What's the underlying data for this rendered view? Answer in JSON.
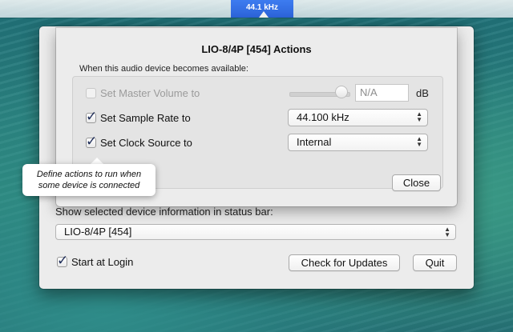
{
  "menubar": {
    "status_item": "44.1 kHz"
  },
  "main_window": {
    "show_label": "Show selected device information in status bar:",
    "device_selected": "LIO-8/4P [454]",
    "start_at_login_label": "Start at Login",
    "start_at_login_checked": true,
    "check_updates_label": "Check for Updates",
    "quit_label": "Quit"
  },
  "sheet": {
    "title": "LIO-8/4P [454] Actions",
    "when_label": "When this audio device becomes available:",
    "rows": [
      {
        "label": "Set Master Volume to",
        "checked": false,
        "enabled": false,
        "value": "N/A",
        "unit": "dB"
      },
      {
        "label": "Set Sample Rate to",
        "checked": true,
        "enabled": true,
        "value": "44.100 kHz"
      },
      {
        "label": "Set Clock Source to",
        "checked": true,
        "enabled": true,
        "value": "Internal"
      }
    ],
    "close_label": "Close"
  },
  "tooltip": {
    "line1": "Define actions to run when",
    "line2": "some device is connected"
  },
  "colors": {
    "status_accent": "#2c63d8",
    "window_bg": "#ececec"
  }
}
